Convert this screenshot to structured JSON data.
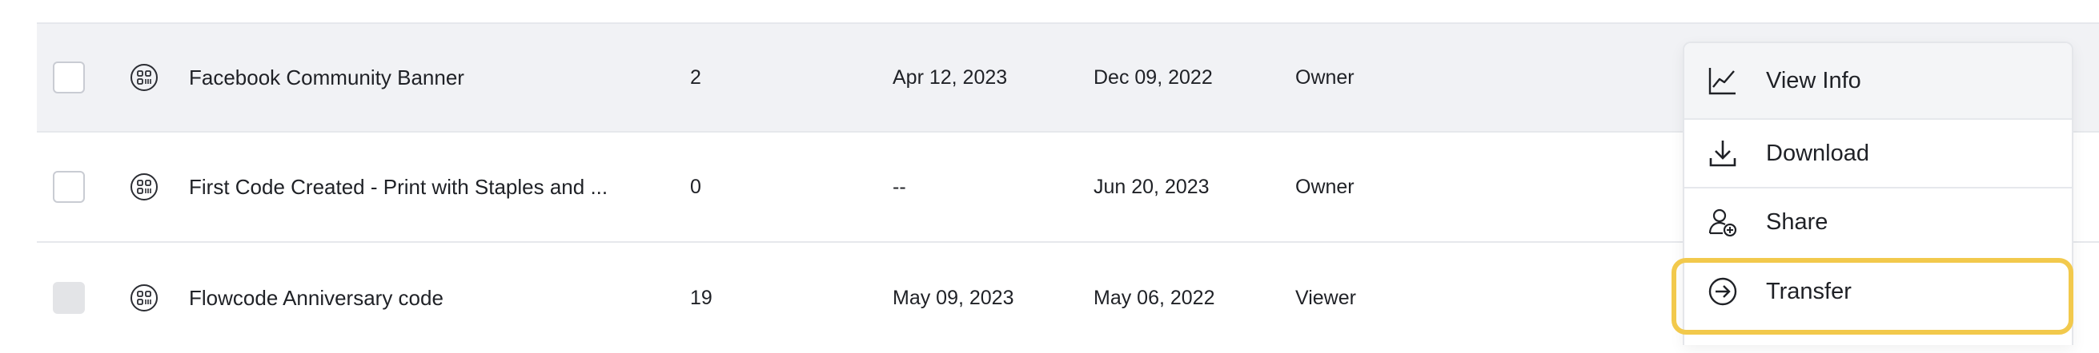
{
  "rows": [
    {
      "name": "Facebook Community Banner",
      "scans": "2",
      "last_scan": "Apr 12, 2023",
      "created": "Dec 09, 2022",
      "role": "Owner"
    },
    {
      "name": "First Code Created - Print with Staples and ...",
      "scans": "0",
      "last_scan": "--",
      "created": "Jun 20, 2023",
      "role": "Owner"
    },
    {
      "name": "Flowcode Anniversary code",
      "scans": "19",
      "last_scan": "May 09, 2023",
      "created": "May 06, 2022",
      "role": "Viewer"
    }
  ],
  "menu": {
    "view_info": "View Info",
    "download": "Download",
    "share": "Share",
    "transfer": "Transfer"
  },
  "icons": {
    "row": "qr-code-icon",
    "view_info": "line-chart-icon",
    "download": "download-icon",
    "share": "add-user-icon",
    "transfer": "arrow-circle-right-icon"
  },
  "colors": {
    "highlight": "#f2c94c",
    "hover_row": "#f1f2f5"
  }
}
